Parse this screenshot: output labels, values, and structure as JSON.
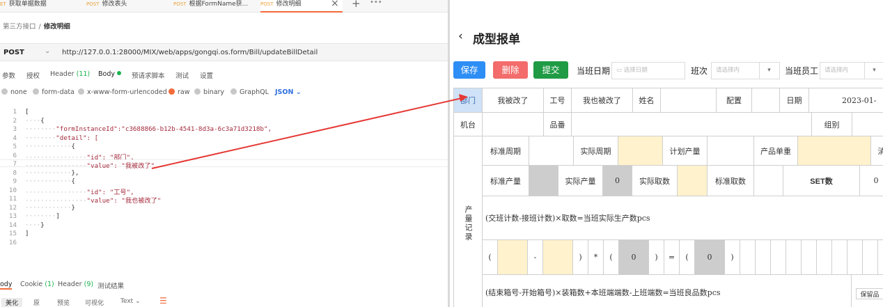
{
  "api_client": {
    "tabs": [
      {
        "method": "ET",
        "name": "获取单据数据"
      },
      {
        "method": "POST",
        "name": "修改表头"
      },
      {
        "method": "POST",
        "name": "根据FormName获..."
      },
      {
        "method": "POST",
        "name": "修改明细"
      }
    ],
    "tab_more": "•••",
    "breadcrumb": {
      "parent": "第三方接口",
      "current": "修改明细"
    },
    "request": {
      "method": "POST",
      "url": "http://127.0.0.1:28000/MIX/web/apps/gongqi.os.form/Bill/updateBillDetail"
    },
    "request_tabs": [
      {
        "label": "参数"
      },
      {
        "label": "授权"
      },
      {
        "label": "Header",
        "count": "(11)"
      },
      {
        "label": "Body"
      },
      {
        "label": "预请求脚本"
      },
      {
        "label": "测试"
      },
      {
        "label": "设置"
      }
    ],
    "body_types": [
      "none",
      "form-data",
      "x-www-form-urlencoded",
      "raw",
      "binary",
      "GraphQL"
    ],
    "body_format": "JSON",
    "code_lines": [
      {
        "n": "1",
        "t": "["
      },
      {
        "n": "2",
        "t": "{"
      },
      {
        "n": "3",
        "t": "\"formInstanceId\":\"c3688866-b12b-4541-8d3a-6c3a71d3218b\","
      },
      {
        "n": "4",
        "t": "\"detail\": ["
      },
      {
        "n": "5",
        "t": "{"
      },
      {
        "n": "6",
        "t": "\"id\": \"部门\","
      },
      {
        "n": "7",
        "t": "\"value\": \"我被改了\""
      },
      {
        "n": "8",
        "t": "},"
      },
      {
        "n": "9",
        "t": "{"
      },
      {
        "n": "10",
        "t": "\"id\": \"工号\","
      },
      {
        "n": "11",
        "t": "\"value\": \"我也被改了\""
      },
      {
        "n": "12",
        "t": "}"
      },
      {
        "n": "13",
        "t": "]"
      },
      {
        "n": "14",
        "t": "}"
      },
      {
        "n": "15",
        "t": "]"
      },
      {
        "n": "16",
        "t": ""
      }
    ],
    "response_tabs": [
      {
        "label": "ody"
      },
      {
        "label": "Cookie",
        "count": "(1)"
      },
      {
        "label": "Header",
        "count": "(9)"
      },
      {
        "label": "测试结果"
      }
    ],
    "response_view": [
      "美化",
      "原",
      "预览",
      "可视化"
    ],
    "response_format": "Text"
  },
  "form": {
    "back": "‹",
    "title": "成型报单",
    "buttons": {
      "save": "保存",
      "delete": "删除",
      "submit": "提交"
    },
    "fields": {
      "date_label": "当班日期",
      "date_placeholder": "选择日期",
      "shift_label": "班次",
      "shift_placeholder": "请选择内",
      "staff_label": "当班员工",
      "staff_placeholder": "请选择内"
    },
    "grid": {
      "r1": [
        "部门",
        "我被改了",
        "工号",
        "我也被改了",
        "姓名",
        "配置",
        "日期",
        "2023-01-"
      ],
      "r2": [
        "机台",
        "品番",
        "组别"
      ],
      "r3": [
        "标准周期",
        "实际周期",
        "计划产量",
        "产品单重",
        "消"
      ],
      "r4": [
        "标准产量",
        "实际产量",
        "0",
        "实际取数",
        "标准取数",
        "SET数",
        "0"
      ],
      "side": "产量记录",
      "formula1": "(交班计数-接班计数)×取数=当班实际生产数pcs",
      "calc": [
        "(",
        "-",
        ")",
        "*",
        "(",
        "0",
        ")",
        "=",
        "(",
        "0",
        ")"
      ],
      "formula2": "(结束箱号-开始箱号)×装箱数+本班端端数-上班端数=当班良品数pcs",
      "keep": "保留品"
    }
  }
}
